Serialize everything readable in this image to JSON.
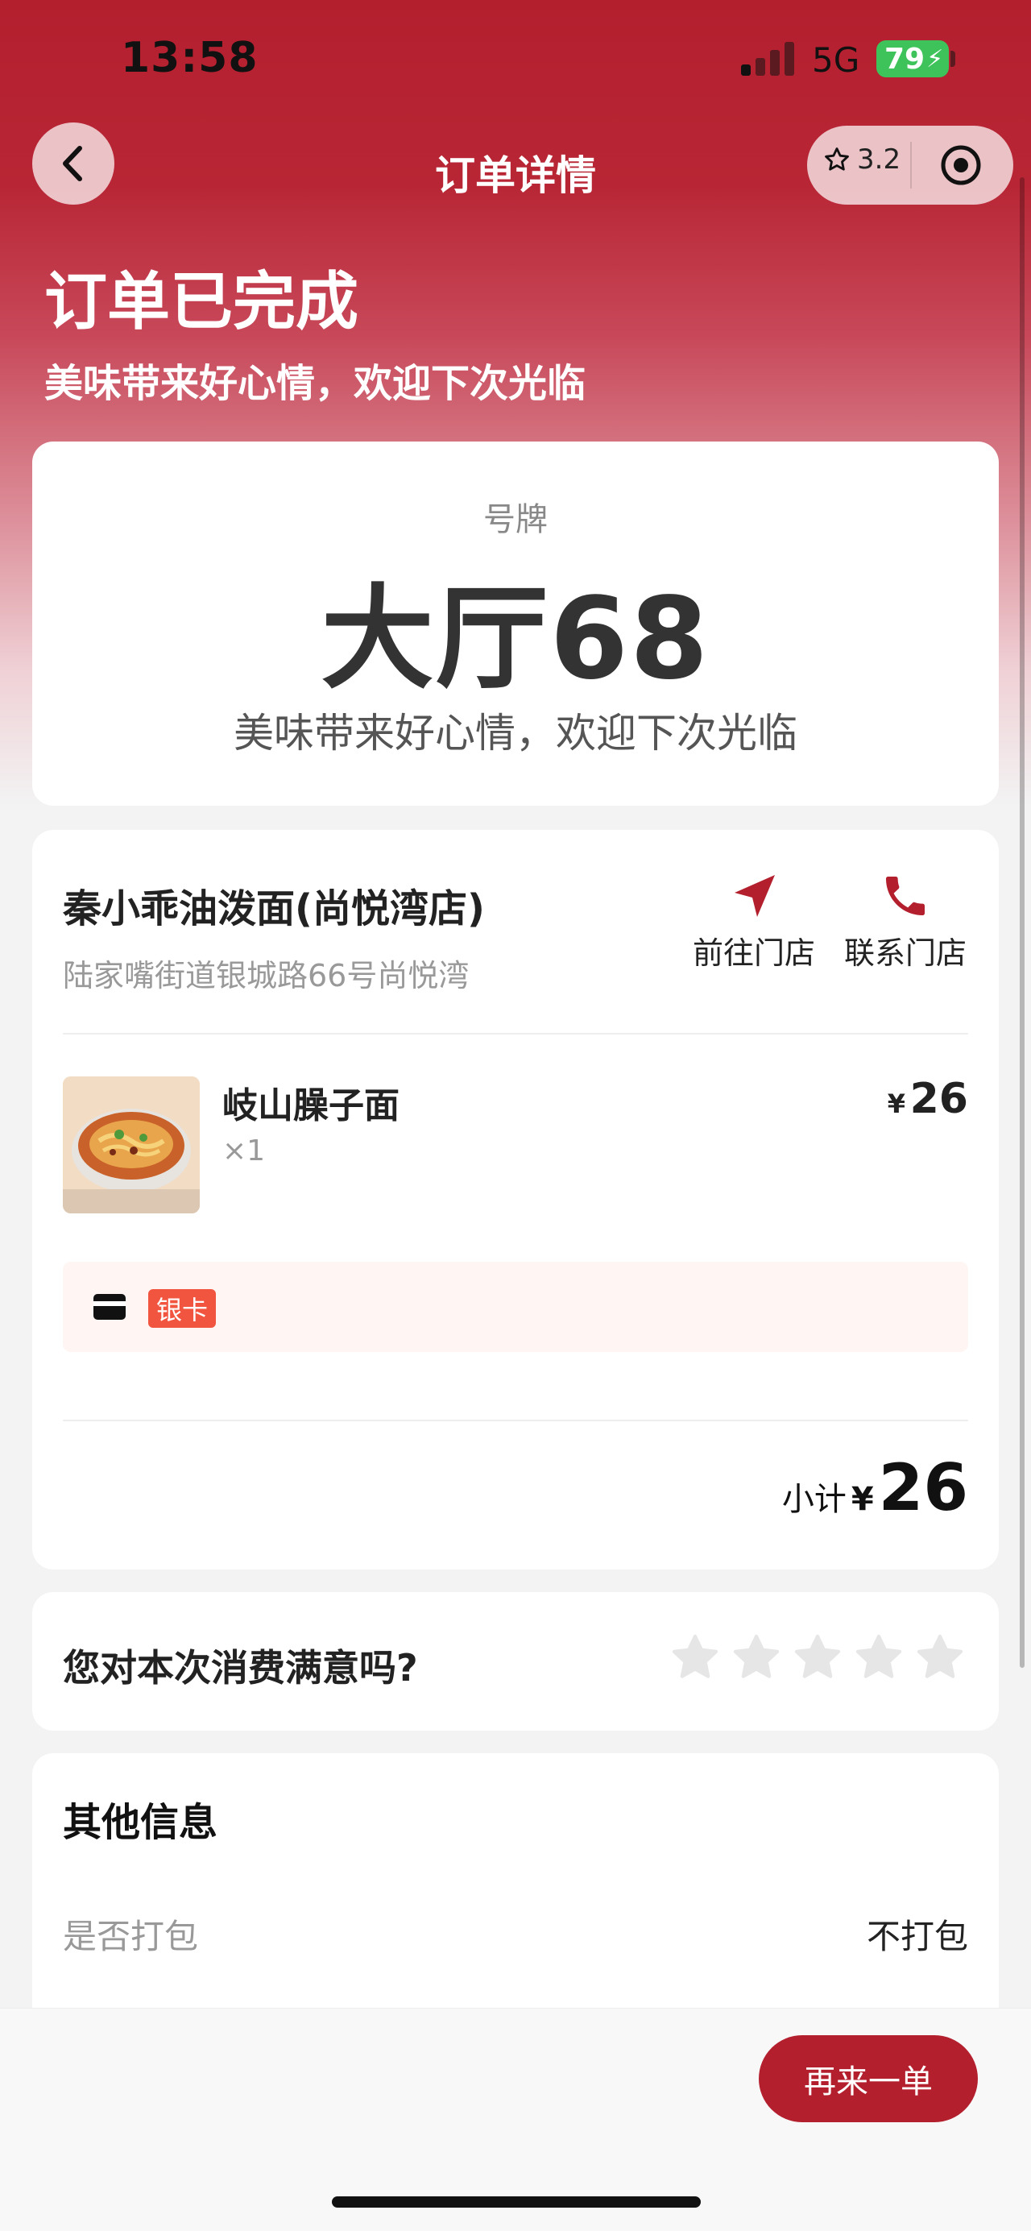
{
  "status_bar": {
    "time": "13:58",
    "network": "5G",
    "battery": "79"
  },
  "nav": {
    "title": "订单详情",
    "rating": "3.2"
  },
  "header": {
    "status": "订单已完成",
    "subtitle": "美味带来好心情，欢迎下次光临"
  },
  "plate": {
    "label": "号牌",
    "number": "大厅68",
    "note": "美味带来好心情，欢迎下次光临"
  },
  "store": {
    "name": "秦小乖油泼面(尚悦湾店)",
    "address": "陆家嘴街道银城路66号尚悦湾",
    "navigate_label": "前往门店",
    "contact_label": "联系门店"
  },
  "order": {
    "items": [
      {
        "name": "岐山臊子面",
        "qty": "×1",
        "currency": "¥",
        "price": "26"
      }
    ],
    "payment_badge": "银卡",
    "subtotal_label": "小计",
    "subtotal_currency": "¥",
    "subtotal_value": "26"
  },
  "rating": {
    "question": "您对本次消费满意吗?",
    "stars_total": 5,
    "stars_selected": 0
  },
  "other_info": {
    "title": "其他信息",
    "rows": [
      {
        "label": "是否打包",
        "value": "不打包"
      }
    ]
  },
  "footer": {
    "reorder_label": "再来一单"
  },
  "icons": {
    "back": "chevron-left-icon",
    "star": "star-icon",
    "target": "target-icon",
    "navigate": "navigation-arrow-icon",
    "phone": "phone-icon",
    "card": "card-icon"
  },
  "colors": {
    "brand": "#b41f2e",
    "badge": "#f2553f",
    "battery": "#3ec35a"
  }
}
